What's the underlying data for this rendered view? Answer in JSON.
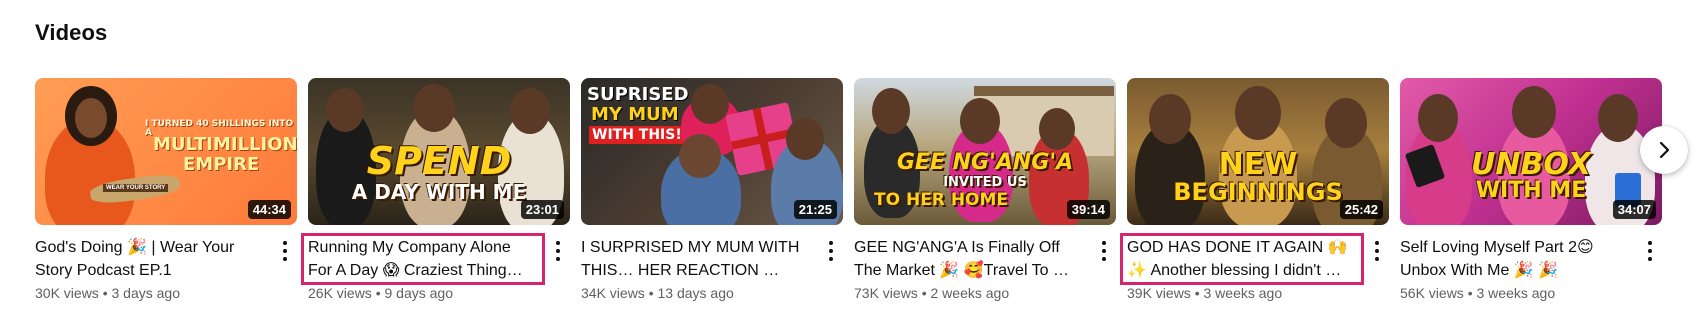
{
  "section": {
    "title": "Videos"
  },
  "videos": [
    {
      "title": "God's Doing 🎉 | Wear Your Story Podcast EP.1",
      "views": "30K views",
      "age": "3 days ago",
      "duration": "44:34",
      "thumb_text": [
        "I TURNED 40 SHILLINGS INTO A",
        "MULTIMILLION",
        "EMPIRE"
      ],
      "thumb_badge": "WEAR YOUR STORY",
      "highlighted": false
    },
    {
      "title": "Running  My Company Alone For A Day 😱 Craziest Thing…",
      "views": "26K views",
      "age": "9 days ago",
      "duration": "23:01",
      "thumb_text": [
        "SPEND",
        "A DAY WITH ME"
      ],
      "highlighted": true
    },
    {
      "title": "I SURPRISED MY MUM WITH THIS… HER REACTION …",
      "views": "34K views",
      "age": "13 days ago",
      "duration": "21:25",
      "thumb_text": [
        "SUPRISED",
        "MY MUM",
        "WITH THIS!"
      ],
      "highlighted": false
    },
    {
      "title": "GEE NG'ANG'A Is Finally Off The Market 🎉 🥰Travel To …",
      "views": "73K views",
      "age": "2 weeks ago",
      "duration": "39:14",
      "thumb_text": [
        "GEE NG'ANG'A",
        "INVITED US",
        "TO HER HOME"
      ],
      "highlighted": false
    },
    {
      "title": "GOD HAS DONE IT AGAIN 🙌 ✨ Another blessing I didn't …",
      "views": "39K views",
      "age": "3 weeks ago",
      "duration": "25:42",
      "thumb_text": [
        "NEW",
        "BEGINNINGS"
      ],
      "highlighted": true
    },
    {
      "title": "Self Loving Myself Part 2😊 Unbox With Me 🎉 🎉",
      "views": "56K views",
      "age": "3 weeks ago",
      "duration": "34:07",
      "thumb_text": [
        "UNBOX",
        "WITH ME"
      ],
      "highlighted": false
    }
  ],
  "separator": "•",
  "icons": {
    "more": "more-vert-icon",
    "next": "chevron-right-icon"
  },
  "colors": {
    "highlight": "#d6246e",
    "text_primary": "#0f0f0f",
    "text_secondary": "#606060"
  }
}
